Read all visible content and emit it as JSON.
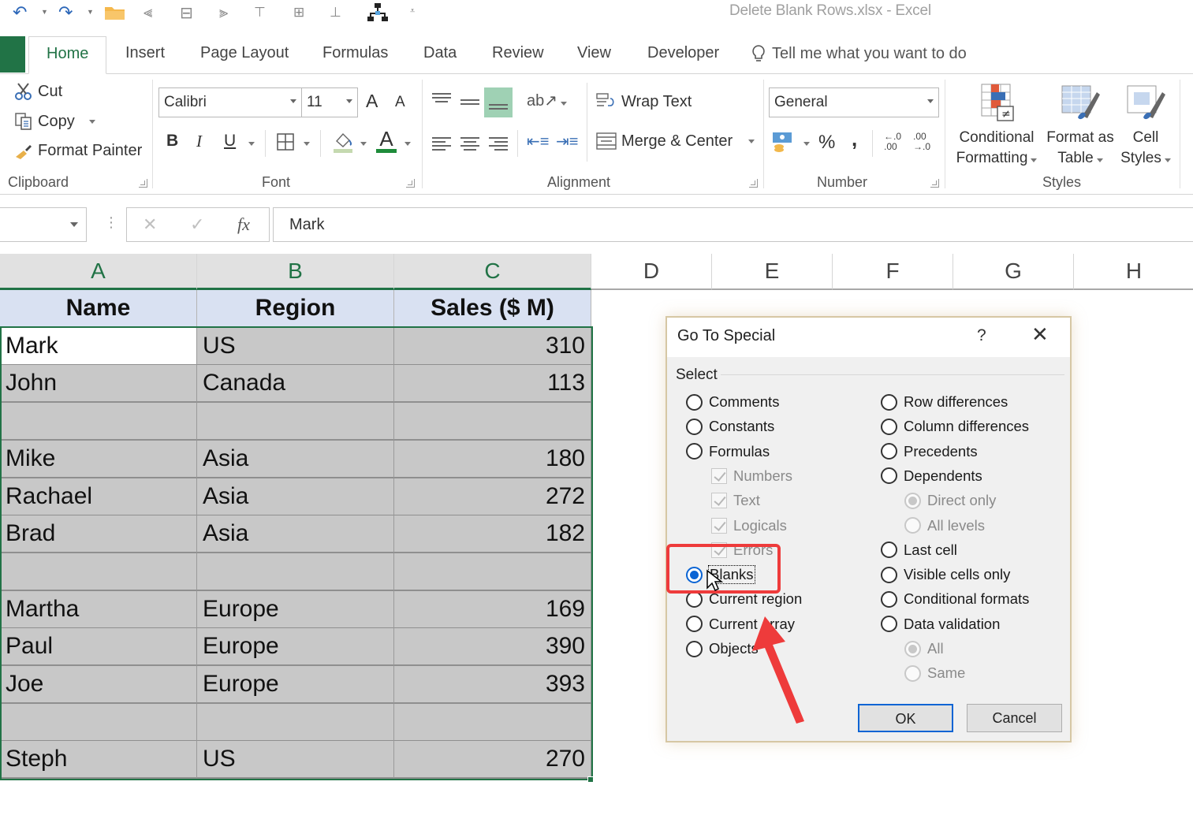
{
  "app": {
    "title": "Delete Blank Rows.xlsx  -  Excel"
  },
  "quick_access": {
    "icons": [
      "undo-icon",
      "redo-icon",
      "open-folder-icon",
      "align-left-icon",
      "align-center-icon",
      "align-right-icon",
      "align-top-icon",
      "align-middle-icon",
      "align-bottom-icon",
      "hierarchy-icon",
      "customize-qat-icon"
    ]
  },
  "tabs": [
    {
      "label": "Home",
      "active": true
    },
    {
      "label": "Insert"
    },
    {
      "label": "Page Layout"
    },
    {
      "label": "Formulas"
    },
    {
      "label": "Data"
    },
    {
      "label": "Review"
    },
    {
      "label": "View"
    },
    {
      "label": "Developer"
    }
  ],
  "tell_me": "Tell me what you want to do",
  "ribbon": {
    "clipboard": {
      "label": "Clipboard",
      "cut": "Cut",
      "copy": "Copy",
      "format_painter": "Format Painter"
    },
    "font": {
      "label": "Font",
      "font_name": "Calibri",
      "font_size": "11",
      "bold": "B",
      "italic": "I",
      "underline": "U",
      "grow": "A",
      "shrink": "A",
      "font_color": "A"
    },
    "alignment": {
      "label": "Alignment",
      "wrap_text": "Wrap Text",
      "merge_center": "Merge & Center"
    },
    "number": {
      "label": "Number",
      "format": "General",
      "percent": "%",
      "comma": ",",
      "inc_decimal": "←.0 .00",
      "dec_decimal": ".00 →.0"
    },
    "styles": {
      "label": "Styles",
      "conditional_formatting": [
        "Conditional",
        "Formatting"
      ],
      "format_as_table": [
        "Format as",
        "Table"
      ],
      "cell_styles": [
        "Cell",
        "Styles"
      ]
    }
  },
  "formula_bar": {
    "name_box": "",
    "cancel": "✕",
    "enter": "✓",
    "fx": "fx",
    "value": "Mark"
  },
  "columns": [
    "A",
    "B",
    "C",
    "D",
    "E",
    "F",
    "G",
    "H"
  ],
  "sheet": {
    "header": [
      "Name",
      "Region",
      "Sales ($ M)"
    ],
    "rows": [
      [
        "Mark",
        "US",
        "310"
      ],
      [
        "John",
        "Canada",
        "113"
      ],
      [
        "",
        "",
        ""
      ],
      [
        "Mike",
        "Asia",
        "180"
      ],
      [
        "Rachael",
        "Asia",
        "272"
      ],
      [
        "Brad",
        "Asia",
        "182"
      ],
      [
        "",
        "",
        ""
      ],
      [
        "Martha",
        "Europe",
        "169"
      ],
      [
        "Paul",
        "Europe",
        "390"
      ],
      [
        "Joe",
        "Europe",
        "393"
      ],
      [
        "",
        "",
        ""
      ],
      [
        "Steph",
        "US",
        "270"
      ]
    ]
  },
  "dialog": {
    "title": "Go To Special",
    "help": "?",
    "close": "✕",
    "group_label": "Select",
    "left_options": [
      {
        "label": "Comments",
        "type": "radio",
        "checked": false
      },
      {
        "label": "Constants",
        "type": "radio",
        "checked": false
      },
      {
        "label": "Formulas",
        "type": "radio",
        "checked": false
      },
      {
        "label": "Numbers",
        "type": "check",
        "checked": true,
        "disabled": true
      },
      {
        "label": "Text",
        "type": "check",
        "checked": true,
        "disabled": true
      },
      {
        "label": "Logicals",
        "type": "check",
        "checked": true,
        "disabled": true
      },
      {
        "label": "Errors",
        "type": "check",
        "checked": true,
        "disabled": true
      },
      {
        "label": "Blanks",
        "type": "radio",
        "checked": true
      },
      {
        "label": "Current region",
        "type": "radio",
        "checked": false
      },
      {
        "label": "Current array",
        "type": "radio",
        "checked": false
      },
      {
        "label": "Objects",
        "type": "radio",
        "checked": false
      }
    ],
    "right_options": [
      {
        "label": "Row differences",
        "type": "radio",
        "checked": false
      },
      {
        "label": "Column differences",
        "type": "radio",
        "checked": false
      },
      {
        "label": "Precedents",
        "type": "radio",
        "checked": false
      },
      {
        "label": "Dependents",
        "type": "radio",
        "checked": false
      },
      {
        "label": "Direct only",
        "type": "radio",
        "checked": true,
        "disabled": true
      },
      {
        "label": "All levels",
        "type": "radio",
        "checked": false,
        "disabled": true
      },
      {
        "label": "Last cell",
        "type": "radio",
        "checked": false
      },
      {
        "label": "Visible cells only",
        "type": "radio",
        "checked": false
      },
      {
        "label": "Conditional formats",
        "type": "radio",
        "checked": false
      },
      {
        "label": "Data validation",
        "type": "radio",
        "checked": false
      },
      {
        "label": "All",
        "type": "radio",
        "checked": true,
        "disabled": true
      },
      {
        "label": "Same",
        "type": "radio",
        "checked": false,
        "disabled": true
      }
    ],
    "ok": "OK",
    "cancel": "Cancel"
  },
  "colors": {
    "excel_green": "#217346",
    "selection_fill": "#c8c8c8",
    "header_fill": "#d9e1f2",
    "dialog_accent": "#0a64d4",
    "annotation_red": "#ee3b3b"
  }
}
